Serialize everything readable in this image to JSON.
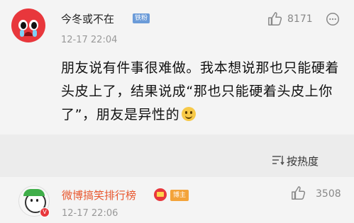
{
  "comment1": {
    "username": "今冬或不在",
    "badge": "铁粉",
    "timestamp": "12-17 22:04",
    "likes": "8171",
    "content": "朋友说有件事很难做。我本想说那也只能硬着头皮上了，结果说成“那也只能硬着头皮上你了”，朋友是异性的",
    "emoji": "smile-emoji",
    "avatar_icon": "crying-face-avatar"
  },
  "sort": {
    "label": "按热度",
    "icon": "sort-icon"
  },
  "comment2": {
    "username": "微博搞笑排行榜",
    "badge": "博主",
    "timestamp": "12-17 22:06",
    "likes": "3508",
    "avatar_icon": "cartoon-avatar",
    "verified_badge": "V"
  },
  "colors": {
    "accent_orange": "#e8572e",
    "badge_blue": "#6b9bd8",
    "badge_orange": "#f3a33a",
    "text_gray": "#999999"
  }
}
